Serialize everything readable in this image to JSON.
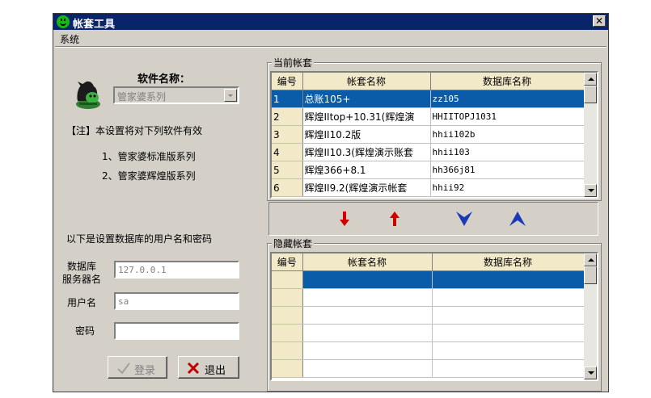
{
  "window": {
    "title": "帐套工具",
    "close_label": "✕"
  },
  "menu": {
    "items": [
      "系统"
    ]
  },
  "left": {
    "software_name_label": "软件名称：",
    "software_combo_value": "管家婆系列",
    "note_line": "【注】本设置将对下列软件有效",
    "note_item_1": "1、管家婆标准版系列",
    "note_item_2": "2、管家婆辉煌版系列",
    "db_settings_intro": "以下是设置数据库的用户名和密码",
    "server_label_1": "数据库",
    "server_label_2": "服务器名",
    "server_value": "127.0.0.1",
    "user_label": "用户名",
    "user_value": "sa",
    "password_label": "密码",
    "password_value": "",
    "login_button": "登录",
    "exit_button": "退出"
  },
  "current_sets": {
    "group_title": "当前帐套",
    "columns": [
      "编号",
      "帐套名称",
      "数据库名称"
    ],
    "rows": [
      {
        "no": "1",
        "name": "总账105+",
        "db": "zz105"
      },
      {
        "no": "2",
        "name": "辉煌IItop+10.31(辉煌演",
        "db": "HHIITOPJ1031"
      },
      {
        "no": "3",
        "name": "辉煌II10.2版",
        "db": "hhii102b"
      },
      {
        "no": "4",
        "name": "辉煌II10.3(辉煌演示账套",
        "db": "hhii103"
      },
      {
        "no": "5",
        "name": "辉煌366+8.1",
        "db": "hh366j81"
      },
      {
        "no": "6",
        "name": "辉煌II9.2(辉煌演示帐套",
        "db": "hhii92"
      }
    ],
    "selected_row": 1
  },
  "hidden_sets": {
    "group_title": "隐藏帐套",
    "columns": [
      "编号",
      "帐套名称",
      "数据库名称"
    ],
    "rows": []
  },
  "arrows": {
    "move_down_icon": "red-down-arrow-icon",
    "move_up_icon": "red-up-arrow-icon",
    "hide_icon": "blue-down-arrowhead-icon",
    "show_icon": "blue-up-arrowhead-icon"
  },
  "colors": {
    "title_bar": "#0a246a",
    "selection": "#0a5ca8",
    "header_bg": "#f2e9c8",
    "face": "#d4d0c8"
  }
}
